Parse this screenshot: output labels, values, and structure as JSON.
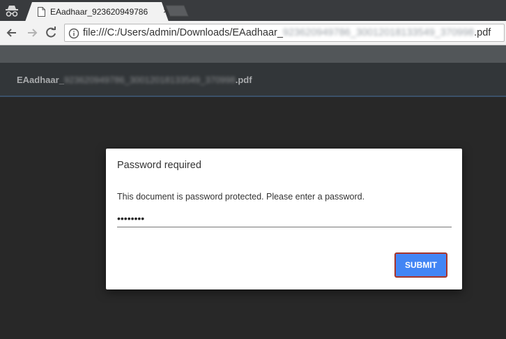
{
  "tab": {
    "title": "EAadhaar_923620949786",
    "close_glyph": "×"
  },
  "toolbar": {
    "url_visible_start": "file:///C:/Users/admin/Downloads/EAadhaar_",
    "url_obscured": "923620949786_30012018133549_370998",
    "url_visible_end": ".pdf"
  },
  "pdf_header": {
    "doc_visible_start": "EAadhaar_",
    "doc_obscured": "923620949786_30012018133549_370998",
    "doc_visible_end": ".pdf"
  },
  "dialog": {
    "heading": "Password required",
    "message": "This document is password protected. Please enter a password.",
    "password_value": "••••••••",
    "submit_label": "SUBMIT"
  },
  "icons": {
    "incognito": "incognito-icon",
    "file": "file-icon",
    "back": "back-arrow-icon",
    "forward": "forward-arrow-icon",
    "reload": "reload-icon",
    "info": "info-icon",
    "close": "close-icon"
  },
  "colors": {
    "submit_button": "#4285f4",
    "pdf_header_bg": "#323639",
    "viewer_bg": "#282828"
  }
}
